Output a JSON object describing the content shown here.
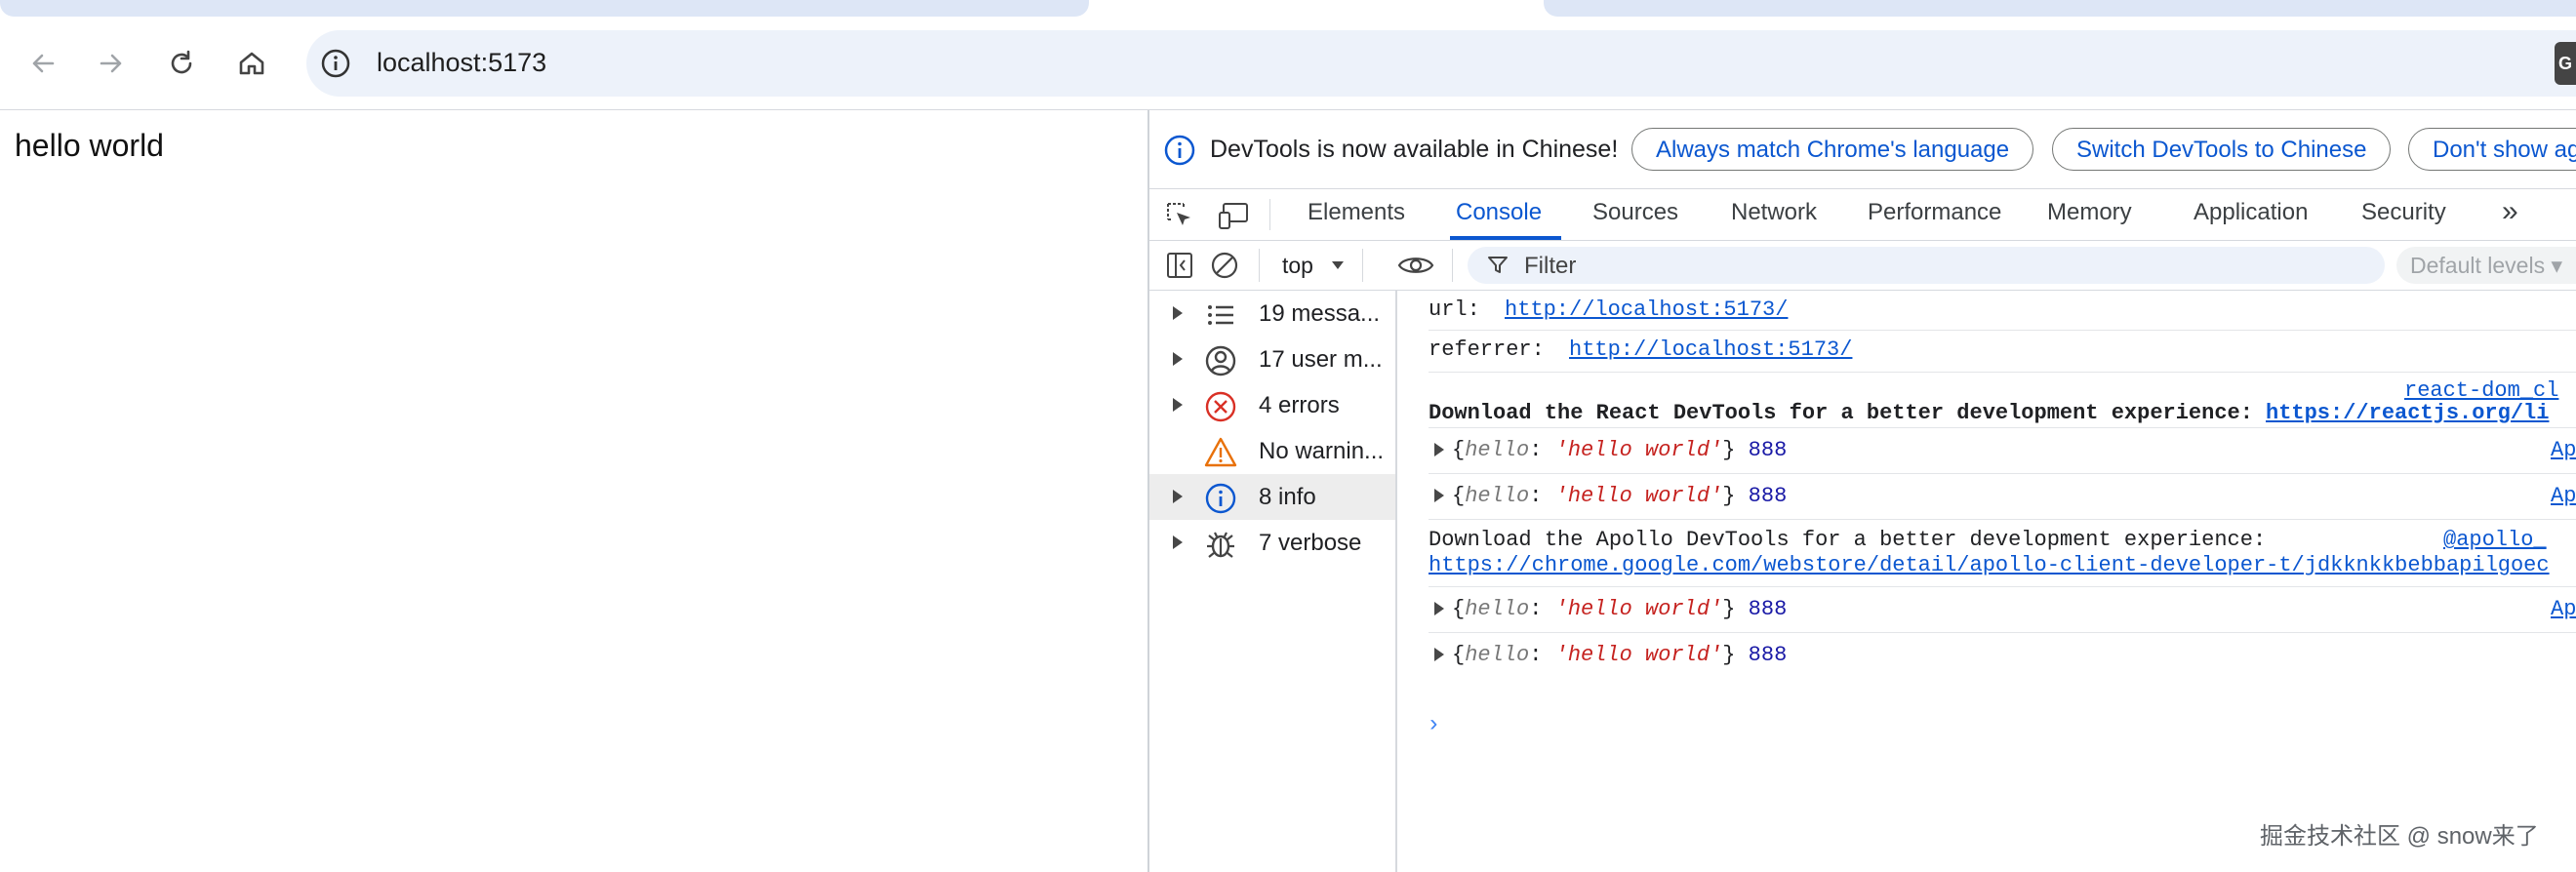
{
  "browser": {
    "url": "localhost:5173",
    "translate_icon": "G"
  },
  "page": {
    "text": "hello world"
  },
  "devtools": {
    "infobar": {
      "message": "DevTools is now available in Chinese!",
      "btn_match": "Always match Chrome's language",
      "btn_switch": "Switch DevTools to Chinese",
      "btn_dont_show": "Don't show ag"
    },
    "tabs": [
      "Elements",
      "Console",
      "Sources",
      "Network",
      "Performance",
      "Memory",
      "Application",
      "Security"
    ],
    "more_tabs": "»",
    "console_toolbar": {
      "context": "top",
      "filter_placeholder": "Filter",
      "levels": "Default levels"
    },
    "sidebar": [
      {
        "label": "19 messa...",
        "icon": "list-icon"
      },
      {
        "label": "17 user m...",
        "icon": "user-icon"
      },
      {
        "label": "4 errors",
        "icon": "error-icon"
      },
      {
        "label": "No warnin...",
        "icon": "warning-icon"
      },
      {
        "label": "8 info",
        "icon": "info-icon"
      },
      {
        "label": "7 verbose",
        "icon": "bug-icon"
      }
    ],
    "console": {
      "url_label": "url:",
      "url_value": "http://localhost:5173/",
      "referrer_label": "referrer:",
      "referrer_value": "http://localhost:5173/",
      "react_source": "react-dom_cl",
      "react_msg": "Download the React DevTools for a better development experience:",
      "react_link": "https://reactjs.org/li",
      "obj_key": "hello",
      "obj_val": "'hello world'",
      "obj_num": "888",
      "obj_source": "Ap",
      "apollo_msg": "Download the Apollo DevTools for a better development experience:",
      "apollo_source": "@apollo_",
      "apollo_link": "https://chrome.google.com/webstore/detail/apollo-client-developer-t/jdkknkkbebbapilgoec",
      "prompt": "›"
    }
  },
  "watermark": "掘金技术社区 @ snow来了",
  "colors": {
    "accent": "#0b57d0",
    "error": "#d93025",
    "warning": "#e8710a"
  }
}
